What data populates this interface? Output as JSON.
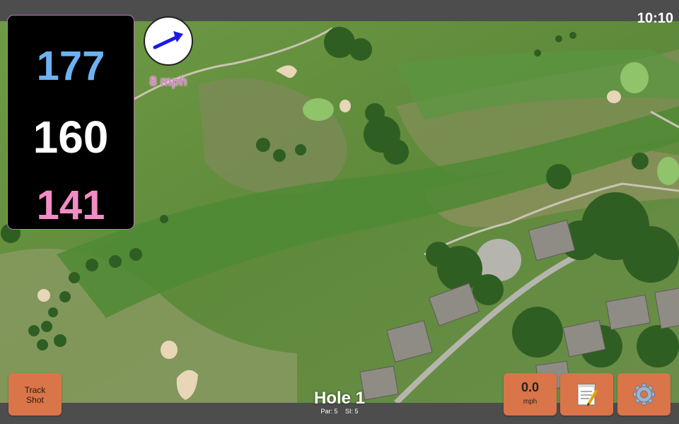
{
  "status_bar": {
    "time": "10:10"
  },
  "distances": {
    "back": "177",
    "middle": "160",
    "front": "141"
  },
  "wind": {
    "speed": "8 mph",
    "direction_icon": "arrow-right-up-icon"
  },
  "buttons": {
    "track_shot_line1": "Track",
    "track_shot_line2": "Shot",
    "speed_value": "0.0",
    "speed_unit": "mph",
    "notes_icon": "memo-icon",
    "settings_icon": "gear-icon"
  },
  "hole": {
    "title": "Hole 1",
    "par": "Par: 5",
    "si": "SI: 5"
  },
  "colors": {
    "back_distance": "#6cb2f2",
    "middle_distance": "#ffffff",
    "front_distance": "#f28cc6",
    "button_bg": "#d97548",
    "wind_label": "#e879d9"
  }
}
